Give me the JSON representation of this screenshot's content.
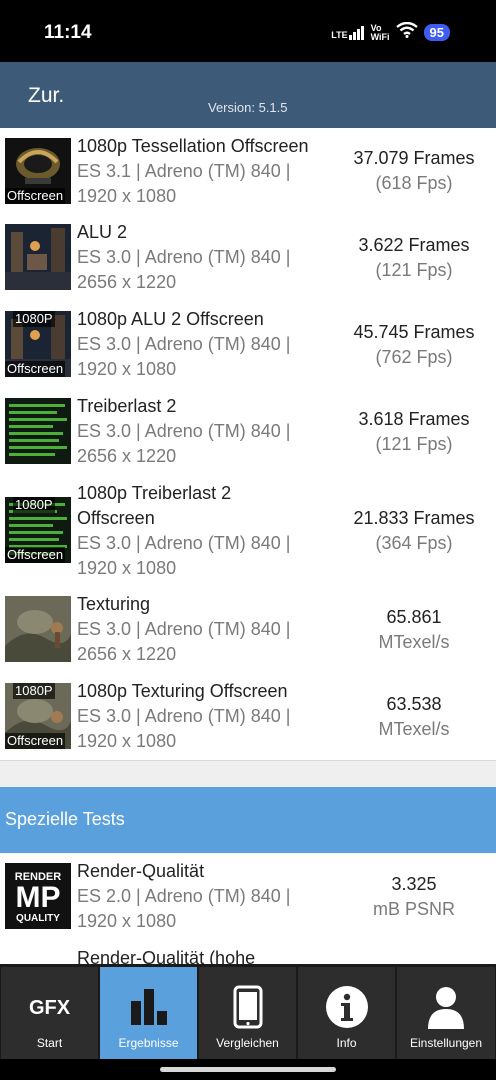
{
  "status": {
    "time": "11:14",
    "lte": "LTE",
    "vo": "Vo",
    "wifi": "WiFi",
    "battery": "95"
  },
  "header": {
    "back_label": "Zur.",
    "version": "Version: 5.1.5"
  },
  "tests": [
    {
      "title": "1080p Tessellation Offscreen",
      "detail": "ES 3.1 | Adreno (TM) 840 | 1920 x 1080",
      "score": "37.079 Frames",
      "unit": "(618 Fps)",
      "tag_top": "",
      "tag_bottom": "Offscreen"
    },
    {
      "title": "ALU 2",
      "detail": "ES 3.0 | Adreno (TM) 840 | 2656 x 1220",
      "score": "3.622 Frames",
      "unit": "(121 Fps)",
      "tag_top": "",
      "tag_bottom": ""
    },
    {
      "title": "1080p ALU 2 Offscreen",
      "detail": "ES 3.0 | Adreno (TM) 840 | 1920 x 1080",
      "score": "45.745 Frames",
      "unit": "(762 Fps)",
      "tag_top": "1080P",
      "tag_bottom": "Offscreen"
    },
    {
      "title": "Treiberlast 2",
      "detail": "ES 3.0 | Adreno (TM) 840 | 2656 x 1220",
      "score": "3.618 Frames",
      "unit": "(121 Fps)",
      "tag_top": "",
      "tag_bottom": ""
    },
    {
      "title": "1080p Treiberlast 2 Offscreen",
      "detail": "ES 3.0 | Adreno (TM) 840 | 1920 x 1080",
      "score": "21.833 Frames",
      "unit": "(364 Fps)",
      "tag_top": "1080P",
      "tag_bottom": "Offscreen"
    },
    {
      "title": "Texturing",
      "detail": "ES 3.0 | Adreno (TM) 840 | 2656 x 1220",
      "score": "65.861",
      "unit": "MTexel/s",
      "tag_top": "",
      "tag_bottom": ""
    },
    {
      "title": "1080p Texturing Offscreen",
      "detail": "ES 3.0 | Adreno (TM) 840 | 1920 x 1080",
      "score": "63.538",
      "unit": "MTexel/s",
      "tag_top": "1080P",
      "tag_bottom": "Offscreen"
    }
  ],
  "special_section": {
    "title": "Spezielle Tests"
  },
  "special_tests": [
    {
      "title": "Render-Qualität",
      "detail": "ES 2.0 | Adreno (TM) 840 | 1920 x 1080",
      "score": "3.325",
      "unit": "mB PSNR",
      "icon_top": "RENDER",
      "icon_mid": "MP",
      "icon_bottom": "QUALITY"
    },
    {
      "title": "Render-Qualität (hohe",
      "detail": "",
      "score": "",
      "unit": ""
    }
  ],
  "nav": [
    {
      "label": "Start",
      "icon_text": "GFX",
      "active": false
    },
    {
      "label": "Ergebnisse",
      "icon": "bar-chart-icon",
      "active": true
    },
    {
      "label": "Vergleichen",
      "icon": "phone-icon",
      "active": false
    },
    {
      "label": "Info",
      "icon": "info-icon",
      "active": false
    },
    {
      "label": "Einstellungen",
      "icon": "user-icon",
      "active": false
    }
  ],
  "colors": {
    "header": "#3d5a78",
    "section": "#5aa0dc",
    "nav_active": "#5aa0dc",
    "nav_bg": "#2d2d2d"
  }
}
